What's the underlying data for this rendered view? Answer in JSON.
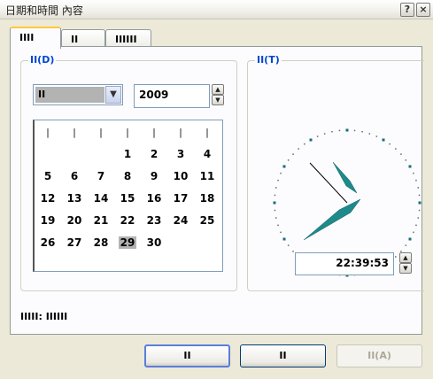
{
  "window": {
    "title": "日期和時間 內容",
    "help_label": "?",
    "close_label": "×"
  },
  "tabs": [
    {
      "label": "IIII"
    },
    {
      "label": "II"
    },
    {
      "label": "IIIIII"
    }
  ],
  "date_group": {
    "label": "II(D)",
    "month_value": "II",
    "year_value": "2009",
    "weekday_headers": [
      "|",
      "|",
      "|",
      "|",
      "|",
      "|",
      "|"
    ],
    "weeks": [
      [
        "",
        "",
        "",
        "1",
        "2",
        "3",
        "4"
      ],
      [
        "5",
        "6",
        "7",
        "8",
        "9",
        "10",
        "11"
      ],
      [
        "12",
        "13",
        "14",
        "15",
        "16",
        "17",
        "18"
      ],
      [
        "19",
        "20",
        "21",
        "22",
        "23",
        "24",
        "25"
      ],
      [
        "26",
        "27",
        "28",
        "29",
        "30",
        "",
        ""
      ]
    ],
    "selected_day": "29"
  },
  "time_group": {
    "label": "II(T)",
    "time_value": "22:39:53"
  },
  "timezone_text": "IIIII: IIIIII",
  "buttons": {
    "ok_label": "II",
    "cancel_label": "II",
    "apply_label": "II(A)"
  },
  "colors": {
    "clock_hands": "#1f8a8a",
    "clock_ticks": "#1a6d7a",
    "group_label": "#0046d5",
    "selected_day_bg": "#b3b3b3"
  }
}
